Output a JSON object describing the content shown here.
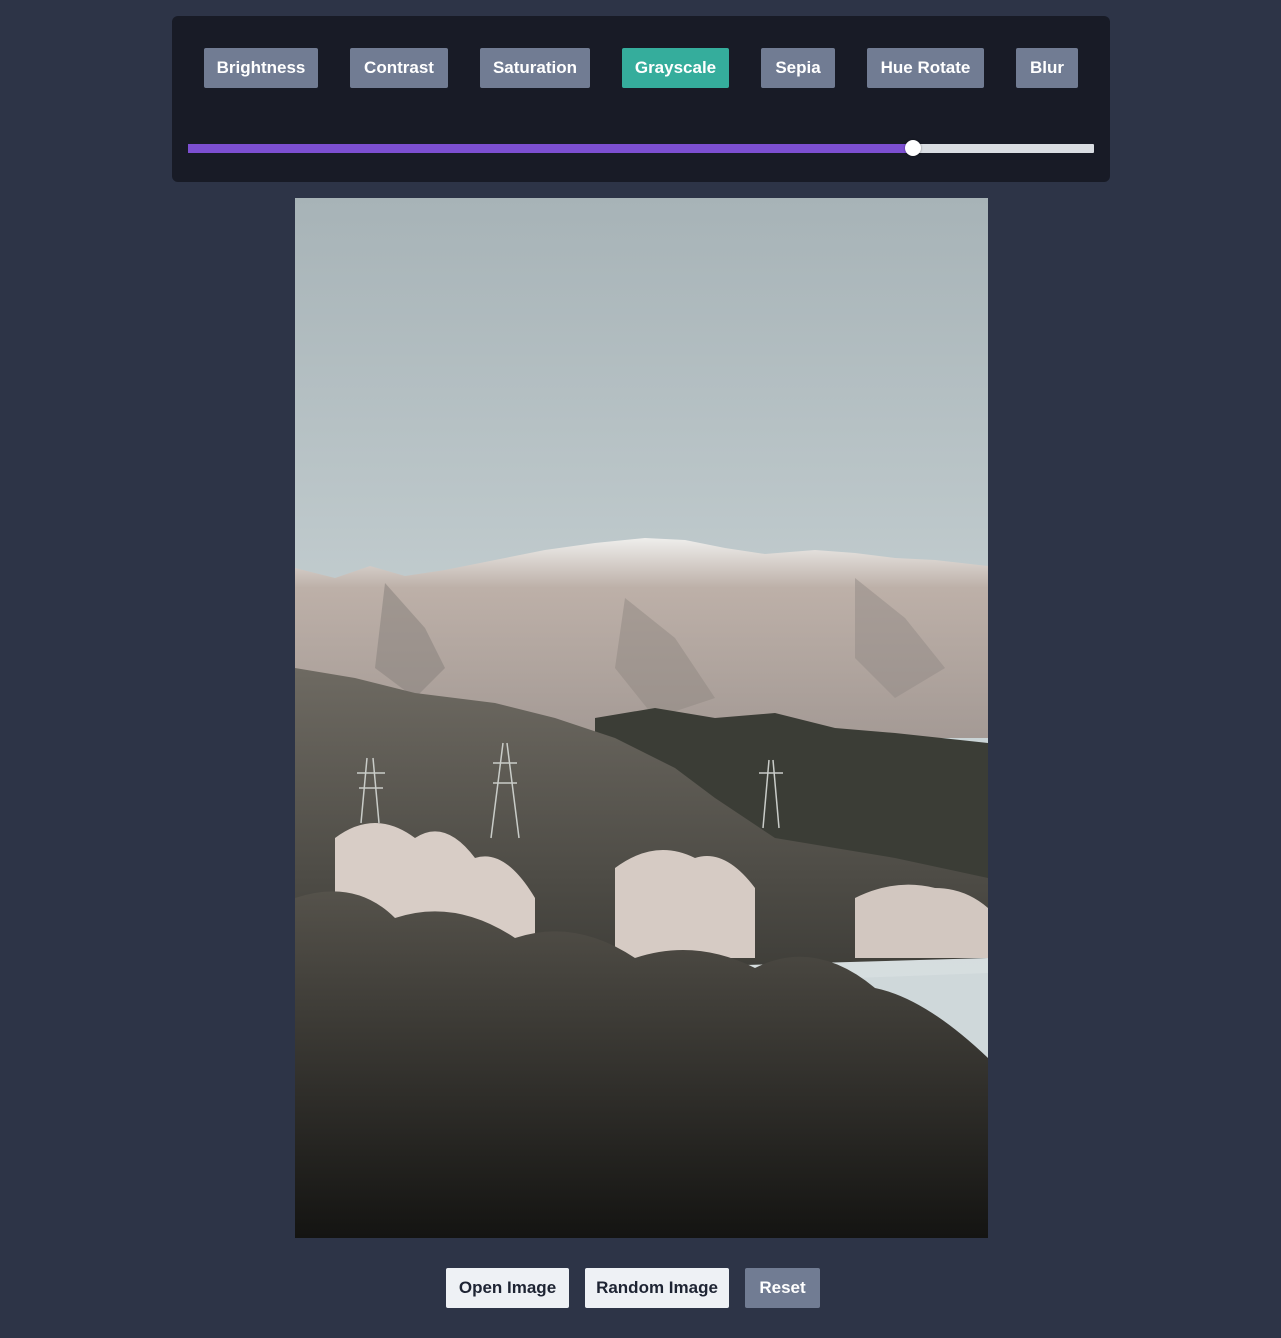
{
  "filters": [
    {
      "label": "Brightness",
      "active": false
    },
    {
      "label": "Contrast",
      "active": false
    },
    {
      "label": "Saturation",
      "active": false
    },
    {
      "label": "Grayscale",
      "active": true
    },
    {
      "label": "Sepia",
      "active": false
    },
    {
      "label": "Hue Rotate",
      "active": false
    },
    {
      "label": "Blur",
      "active": false
    }
  ],
  "slider": {
    "value_fraction": 0.8
  },
  "image": {
    "alt": "photo"
  },
  "actions": {
    "open_label": "Open Image",
    "random_label": "Random Image",
    "reset_label": "Reset"
  },
  "colors": {
    "background": "#2d3447",
    "panel": "#181b26",
    "button": "#717c93",
    "active_button": "#35ad9c",
    "slider_fill": "#7c4fd1",
    "slider_track": "#d9dde2"
  }
}
